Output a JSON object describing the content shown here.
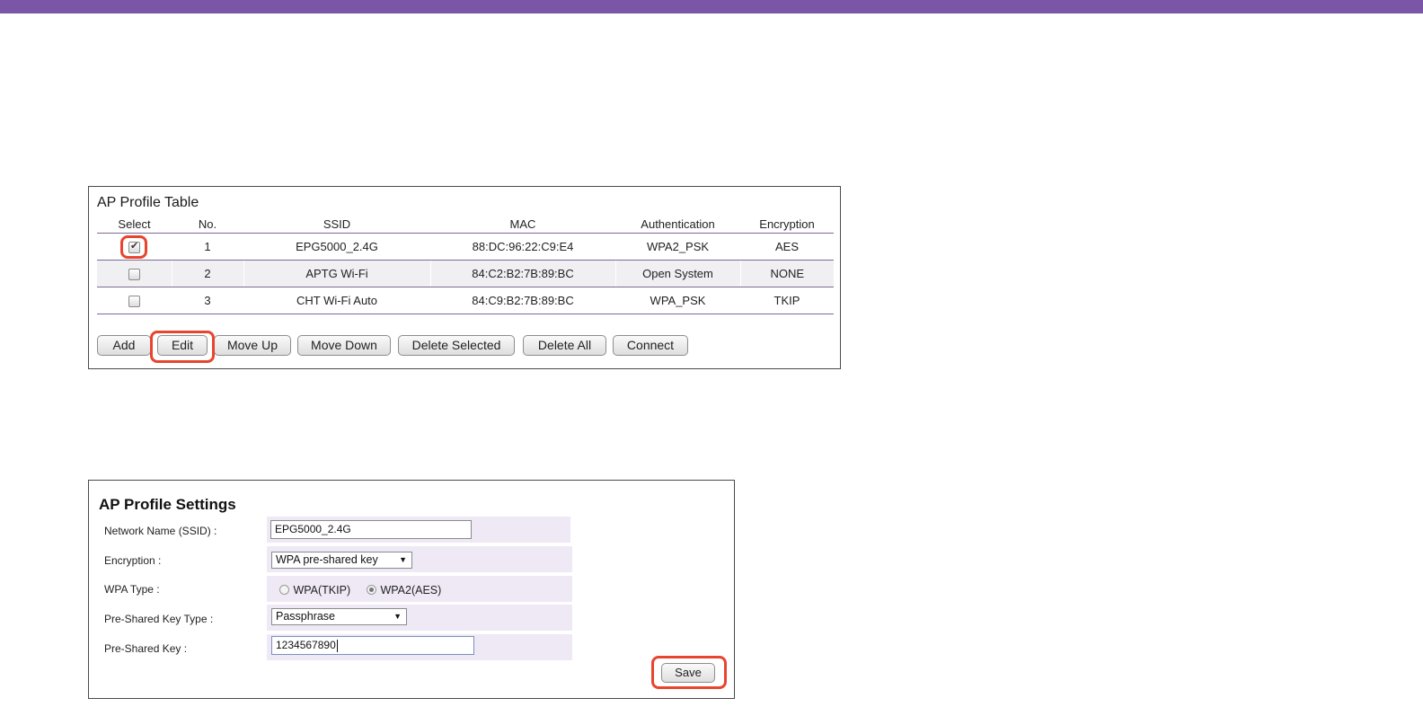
{
  "colors": {
    "topbar": "#7b56a6",
    "highlight": "#e8452f",
    "row_bg": "#efe9f5"
  },
  "ap_table": {
    "title": "AP Profile Table",
    "columns": [
      "Select",
      "No.",
      "SSID",
      "MAC",
      "Authentication",
      "Encryption"
    ],
    "rows": [
      {
        "selected": true,
        "no": "1",
        "ssid": "EPG5000_2.4G",
        "mac": "88:DC:96:22:C9:E4",
        "auth": "WPA2_PSK",
        "enc": "AES"
      },
      {
        "selected": false,
        "no": "2",
        "ssid": "APTG Wi-Fi",
        "mac": "84:C2:B2:7B:89:BC",
        "auth": "Open System",
        "enc": "NONE"
      },
      {
        "selected": false,
        "no": "3",
        "ssid": "CHT Wi-Fi Auto",
        "mac": "84:C9:B2:7B:89:BC",
        "auth": "WPA_PSK",
        "enc": "TKIP"
      }
    ],
    "buttons": {
      "add": "Add",
      "edit": "Edit",
      "move_up": "Move Up",
      "move_down": "Move Down",
      "delete_selected": "Delete Selected",
      "delete_all": "Delete All",
      "connect": "Connect"
    }
  },
  "ap_settings": {
    "title": "AP Profile Settings",
    "ssid_label": "Network Name (SSID) :",
    "ssid_value": "EPG5000_2.4G",
    "encryption_label": "Encryption :",
    "encryption_value": "WPA pre-shared key",
    "wpa_type_label": "WPA Type :",
    "wpa_options": [
      "WPA(TKIP)",
      "WPA2(AES)"
    ],
    "wpa_selected": "WPA2(AES)",
    "psk_type_label": "Pre-Shared Key Type :",
    "psk_type_value": "Passphrase",
    "psk_label": "Pre-Shared Key :",
    "psk_value": "1234567890",
    "save": "Save"
  }
}
